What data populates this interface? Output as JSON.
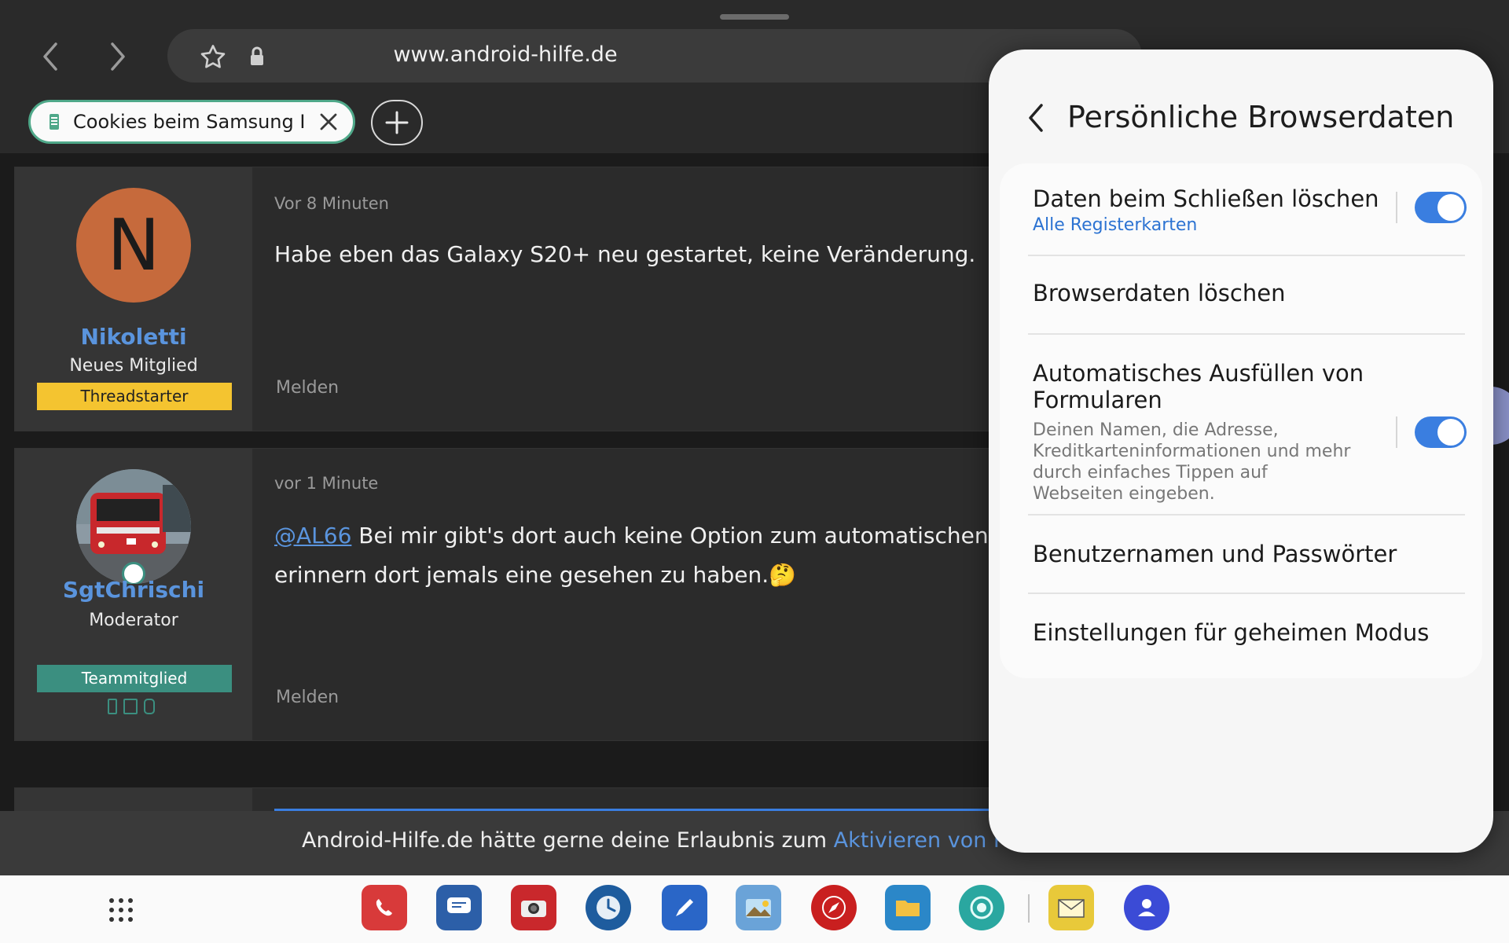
{
  "browser": {
    "url": "www.android-hilfe.de",
    "tab_title": "Cookies beim Samsung I···",
    "icons": [
      "back-arrow-icon",
      "forward-arrow-icon",
      "star-icon",
      "lock-icon",
      "close-icon",
      "plus-icon"
    ]
  },
  "posts": [
    {
      "avatar_letter": "N",
      "username": "Nikoletti",
      "role": "Neues Mitglied",
      "badge": "Threadstarter",
      "time": "Vor 8 Minuten",
      "text": "Habe eben das Galaxy S20+ neu gestartet, keine Veränderung.",
      "report": "Melden"
    },
    {
      "username": "SgtChrischi",
      "role": "Moderator",
      "badge": "Teammitglied",
      "time": "vor 1 Minute",
      "mention": "@AL66",
      "text_line1": " Bei mir gibt's dort auch keine Option zum automatischen Lösc",
      "text_line2": "erinnern dort jemals eine gesehen zu haben.",
      "emoji": "🤔",
      "report": "Melden"
    }
  ],
  "push_banner": {
    "text": "Android-Hilfe.de hätte gerne deine Erlaubnis zum ",
    "link": "Aktivieren von Push-Be"
  },
  "panel": {
    "title": "Persönliche Browserdaten",
    "rows": [
      {
        "title": "Daten beim Schließen löschen",
        "subtitle": "Alle Registerkarten",
        "toggle": true
      },
      {
        "title": "Browserdaten löschen"
      },
      {
        "title_line1": "Automatisches Ausfüllen von",
        "title_line2": "Formularen",
        "description": "Deinen Namen, die Adresse, Kreditkarteninformationen und mehr durch einfaches Tippen auf Webseiten eingeben.",
        "toggle": true
      },
      {
        "title": "Benutzernamen und Passwörter"
      },
      {
        "title": "Einstellungen für geheimen Modus"
      }
    ]
  },
  "colors": {
    "accent_blue": "#3a7ee0",
    "link_blue": "#5a94dd",
    "threadstarter_badge": "#f4c430",
    "teammitglied_badge": "#3b8f80",
    "tab_border": "#4fa889"
  },
  "dock": [
    "apps-grid-icon",
    "phone-app-icon",
    "messages-app-icon",
    "camera-app-icon",
    "clock-app-icon",
    "notes-app-icon",
    "gallery-app-icon",
    "browser-app-icon",
    "files-app-icon",
    "settings-app-icon",
    "email-app-icon",
    "contacts-app-icon"
  ]
}
